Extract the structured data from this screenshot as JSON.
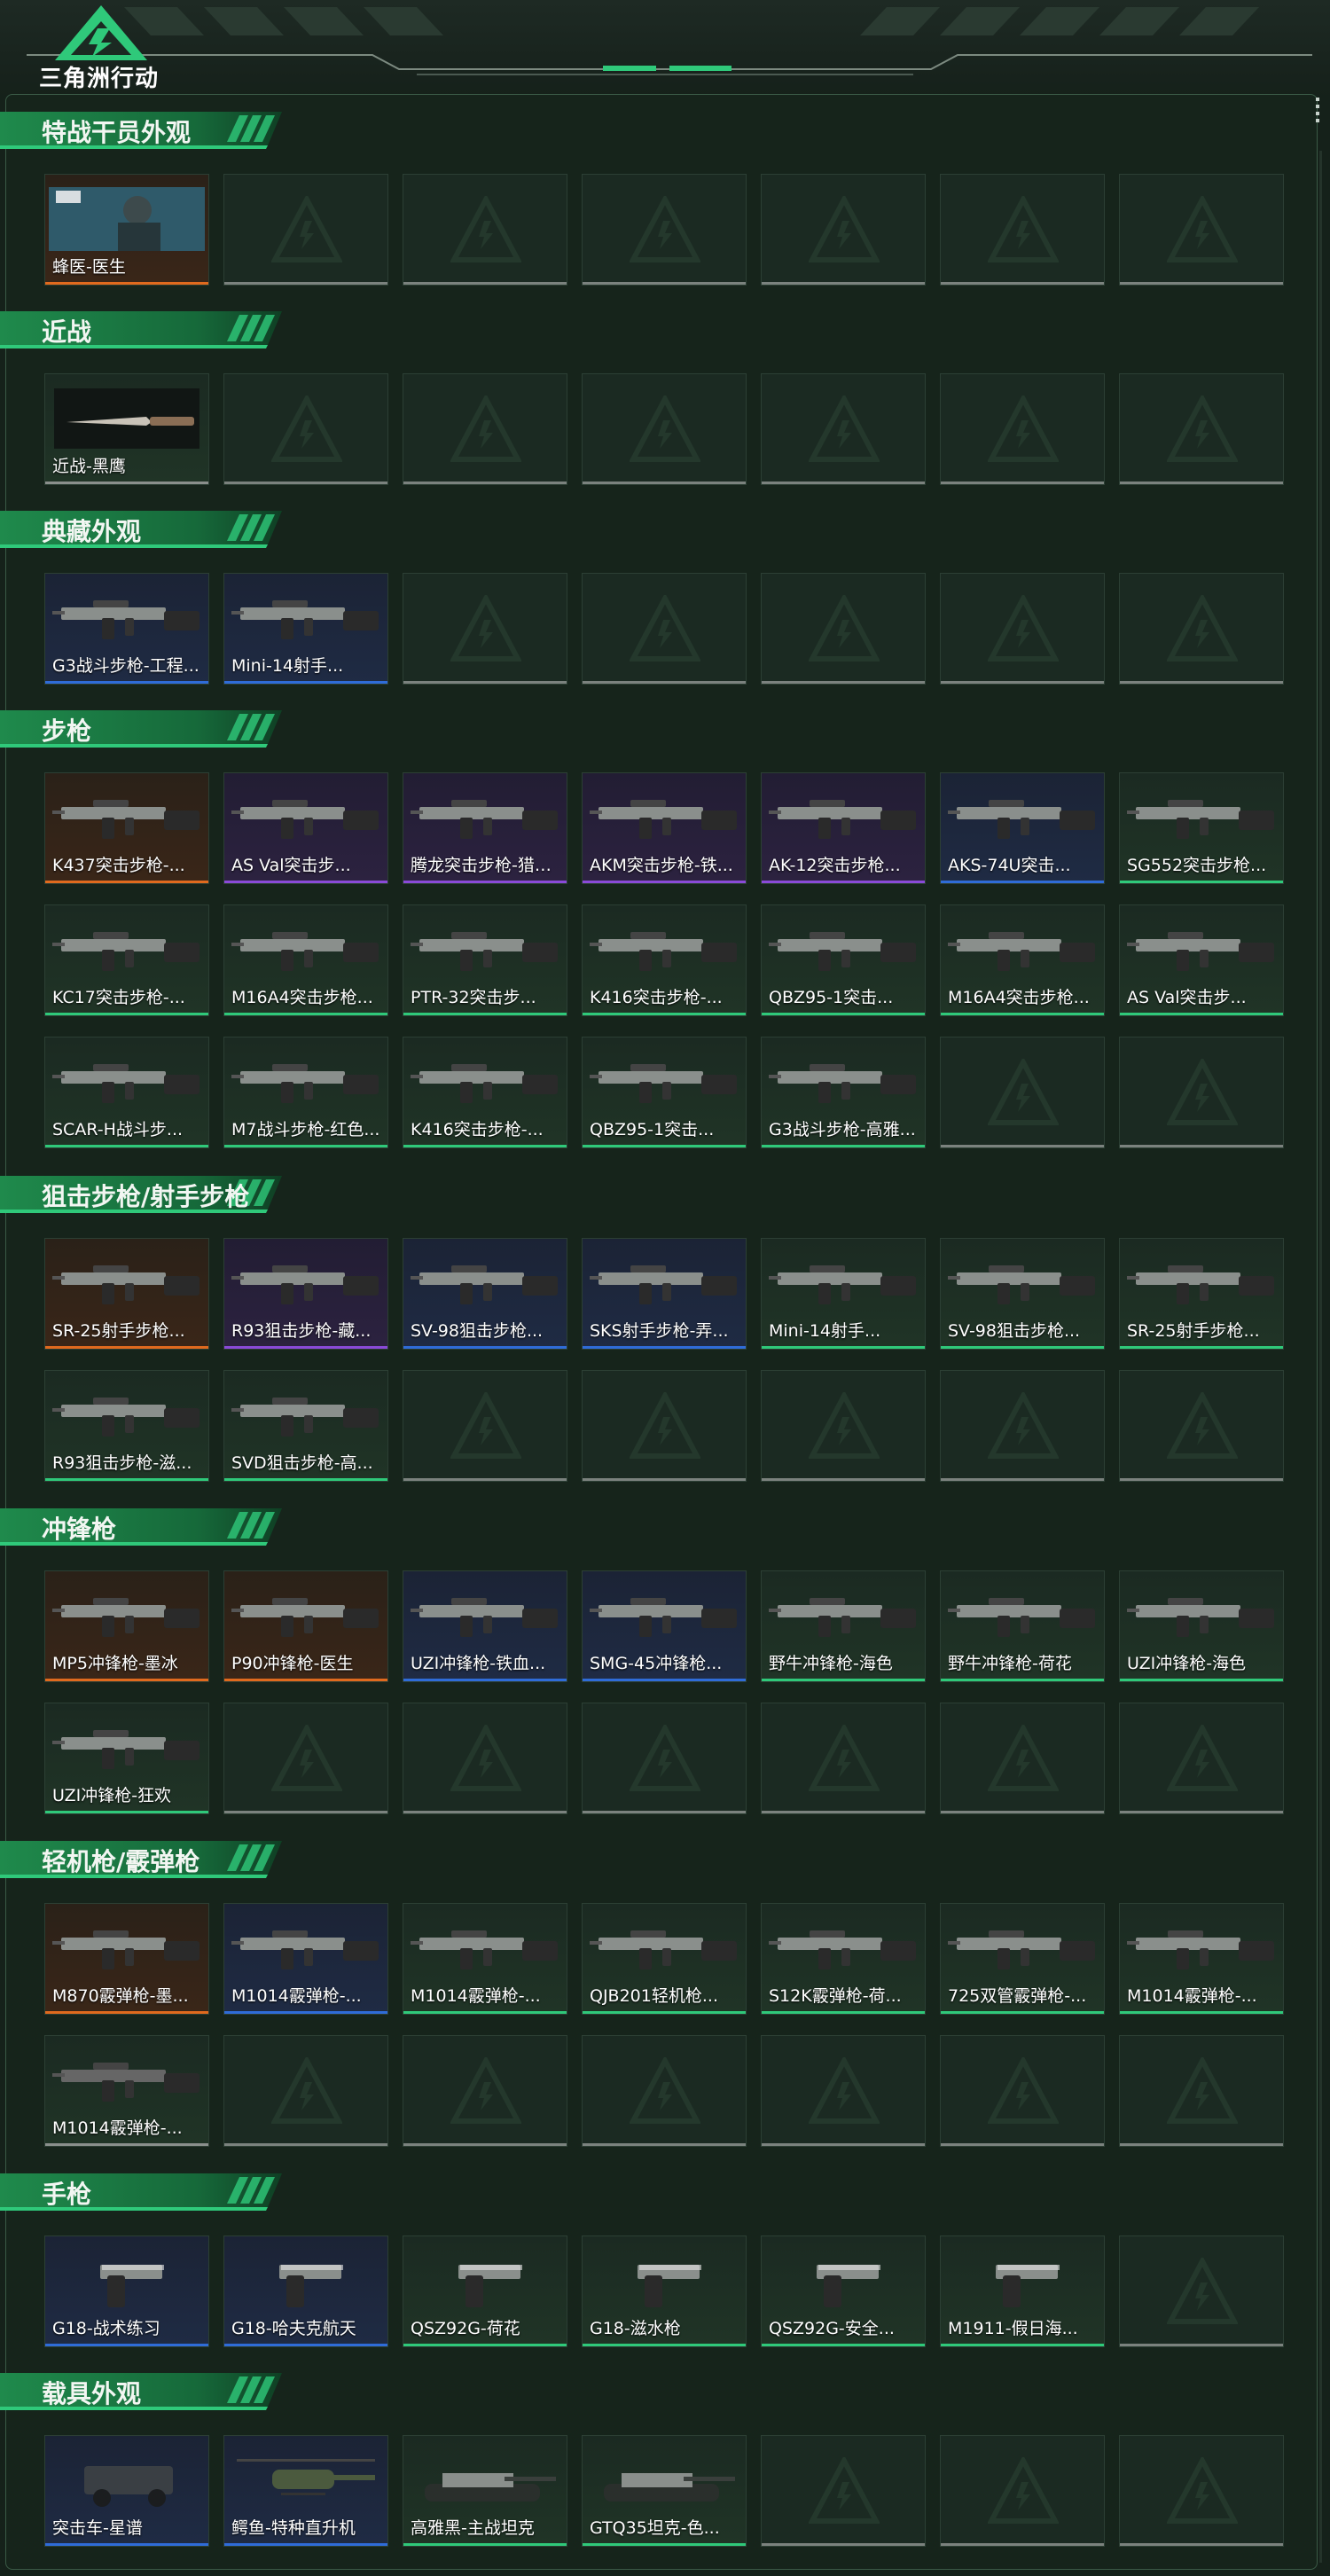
{
  "app": {
    "logo_text": "三角洲行动"
  },
  "colors": {
    "orange": "#e06a1e",
    "purple": "#8a4ad8",
    "blue": "#2f6cd8",
    "green": "#2fc97a",
    "gray": "#8a8f8c",
    "accent": "#2fc97a",
    "background": "#15211a"
  },
  "sections": [
    {
      "title": "特战干员外观",
      "items": [
        {
          "label": "蜂医-医生",
          "rarity": "orange",
          "icon": "operator-portrait-icon"
        }
      ]
    },
    {
      "title": "近战",
      "items": [
        {
          "label": "近战-黑鹰",
          "rarity": "gray",
          "icon": "knife-icon"
        }
      ]
    },
    {
      "title": "典藏外观",
      "items": [
        {
          "label": "G3战斗步枪-工程...",
          "rarity": "blue",
          "icon": "rifle-icon"
        },
        {
          "label": "Mini-14射手...",
          "rarity": "blue",
          "icon": "rifle-icon"
        }
      ]
    },
    {
      "title": "步枪",
      "items": [
        {
          "label": "K437突击步枪-...",
          "rarity": "orange",
          "icon": "rifle-icon"
        },
        {
          "label": "AS Val突击步...",
          "rarity": "purple",
          "icon": "rifle-icon"
        },
        {
          "label": "腾龙突击步枪-猎鳄...",
          "rarity": "purple",
          "icon": "rifle-icon"
        },
        {
          "label": "AKM突击步枪-铁...",
          "rarity": "purple",
          "icon": "rifle-icon"
        },
        {
          "label": "AK-12突击步枪...",
          "rarity": "purple",
          "icon": "rifle-icon"
        },
        {
          "label": "AKS-74U突击...",
          "rarity": "blue",
          "icon": "rifle-icon"
        },
        {
          "label": "SG552突击步枪...",
          "rarity": "green",
          "icon": "rifle-icon"
        },
        {
          "label": "KC17突击步枪-...",
          "rarity": "green",
          "icon": "rifle-icon"
        },
        {
          "label": "M16A4突击步枪...",
          "rarity": "green",
          "icon": "rifle-icon"
        },
        {
          "label": "PTR-32突击步...",
          "rarity": "green",
          "icon": "rifle-icon"
        },
        {
          "label": "K416突击步枪-...",
          "rarity": "green",
          "icon": "rifle-icon"
        },
        {
          "label": "QBZ95-1突击...",
          "rarity": "green",
          "icon": "rifle-icon"
        },
        {
          "label": "M16A4突击步枪...",
          "rarity": "green",
          "icon": "rifle-icon"
        },
        {
          "label": "AS Val突击步...",
          "rarity": "green",
          "icon": "rifle-icon"
        },
        {
          "label": "SCAR-H战斗步...",
          "rarity": "green",
          "icon": "rifle-icon"
        },
        {
          "label": "M7战斗步枪-红色...",
          "rarity": "green",
          "icon": "rifle-icon"
        },
        {
          "label": "K416突击步枪-...",
          "rarity": "green",
          "icon": "rifle-icon"
        },
        {
          "label": "QBZ95-1突击...",
          "rarity": "green",
          "icon": "rifle-icon"
        },
        {
          "label": "G3战斗步枪-高雅...",
          "rarity": "green",
          "icon": "rifle-icon"
        }
      ]
    },
    {
      "title": "狙击步枪/射手步枪",
      "items": [
        {
          "label": "SR-25射手步枪...",
          "rarity": "orange",
          "icon": "sniper-rifle-icon"
        },
        {
          "label": "R93狙击步枪-藏...",
          "rarity": "purple",
          "icon": "sniper-rifle-icon"
        },
        {
          "label": "SV-98狙击步枪...",
          "rarity": "blue",
          "icon": "sniper-rifle-icon"
        },
        {
          "label": "SKS射手步枪-弄...",
          "rarity": "blue",
          "icon": "sniper-rifle-icon"
        },
        {
          "label": "Mini-14射手...",
          "rarity": "green",
          "icon": "sniper-rifle-icon"
        },
        {
          "label": "SV-98狙击步枪...",
          "rarity": "green",
          "icon": "sniper-rifle-icon"
        },
        {
          "label": "SR-25射手步枪...",
          "rarity": "green",
          "icon": "sniper-rifle-icon"
        },
        {
          "label": "R93狙击步枪-滋...",
          "rarity": "green",
          "icon": "sniper-rifle-icon"
        },
        {
          "label": "SVD狙击步枪-高...",
          "rarity": "green",
          "icon": "sniper-rifle-icon"
        }
      ]
    },
    {
      "title": "冲锋枪",
      "items": [
        {
          "label": "MP5冲锋枪-墨冰",
          "rarity": "orange",
          "icon": "smg-icon"
        },
        {
          "label": "P90冲锋枪-医生",
          "rarity": "orange",
          "icon": "smg-icon"
        },
        {
          "label": "UZI冲锋枪-铁血...",
          "rarity": "blue",
          "icon": "smg-icon"
        },
        {
          "label": "SMG-45冲锋枪...",
          "rarity": "blue",
          "icon": "smg-icon"
        },
        {
          "label": "野牛冲锋枪-海色",
          "rarity": "green",
          "icon": "smg-icon"
        },
        {
          "label": "野牛冲锋枪-荷花",
          "rarity": "green",
          "icon": "smg-icon"
        },
        {
          "label": "UZI冲锋枪-海色",
          "rarity": "green",
          "icon": "smg-icon"
        },
        {
          "label": "UZI冲锋枪-狂欢",
          "rarity": "green",
          "icon": "smg-icon"
        }
      ]
    },
    {
      "title": "轻机枪/霰弹枪",
      "items": [
        {
          "label": "M870霰弹枪-墨...",
          "rarity": "orange",
          "icon": "shotgun-icon"
        },
        {
          "label": "M1014霰弹枪-...",
          "rarity": "blue",
          "icon": "shotgun-icon"
        },
        {
          "label": "M1014霰弹枪-...",
          "rarity": "green",
          "icon": "shotgun-icon"
        },
        {
          "label": "QJB201轻机枪...",
          "rarity": "green",
          "icon": "shotgun-icon"
        },
        {
          "label": "S12K霰弹枪-荷...",
          "rarity": "green",
          "icon": "shotgun-icon"
        },
        {
          "label": "725双管霰弹枪-...",
          "rarity": "green",
          "icon": "shotgun-icon"
        },
        {
          "label": "M1014霰弹枪-...",
          "rarity": "green",
          "icon": "shotgun-icon"
        },
        {
          "label": "M1014霰弹枪-...",
          "rarity": "gray",
          "icon": "shotgun-icon"
        }
      ]
    },
    {
      "title": "手枪",
      "items": [
        {
          "label": "G18-战术练习",
          "rarity": "blue",
          "icon": "pistol-icon"
        },
        {
          "label": "G18-哈夫克航天",
          "rarity": "blue",
          "icon": "pistol-icon"
        },
        {
          "label": "QSZ92G-荷花",
          "rarity": "green",
          "icon": "pistol-icon"
        },
        {
          "label": "G18-滋水枪",
          "rarity": "green",
          "icon": "pistol-icon"
        },
        {
          "label": "QSZ92G-安全...",
          "rarity": "green",
          "icon": "pistol-icon"
        },
        {
          "label": "M1911-假日海...",
          "rarity": "green",
          "icon": "pistol-icon"
        }
      ]
    },
    {
      "title": "载具外观",
      "items": [
        {
          "label": "突击车-星谱",
          "rarity": "blue",
          "icon": "assault-vehicle-icon"
        },
        {
          "label": "鳄鱼-特种直升机",
          "rarity": "blue",
          "icon": "helicopter-icon"
        },
        {
          "label": "高雅黑-主战坦克",
          "rarity": "green",
          "icon": "tank-icon"
        },
        {
          "label": "GTQ35坦克-色...",
          "rarity": "green",
          "icon": "tank-icon"
        }
      ]
    }
  ]
}
